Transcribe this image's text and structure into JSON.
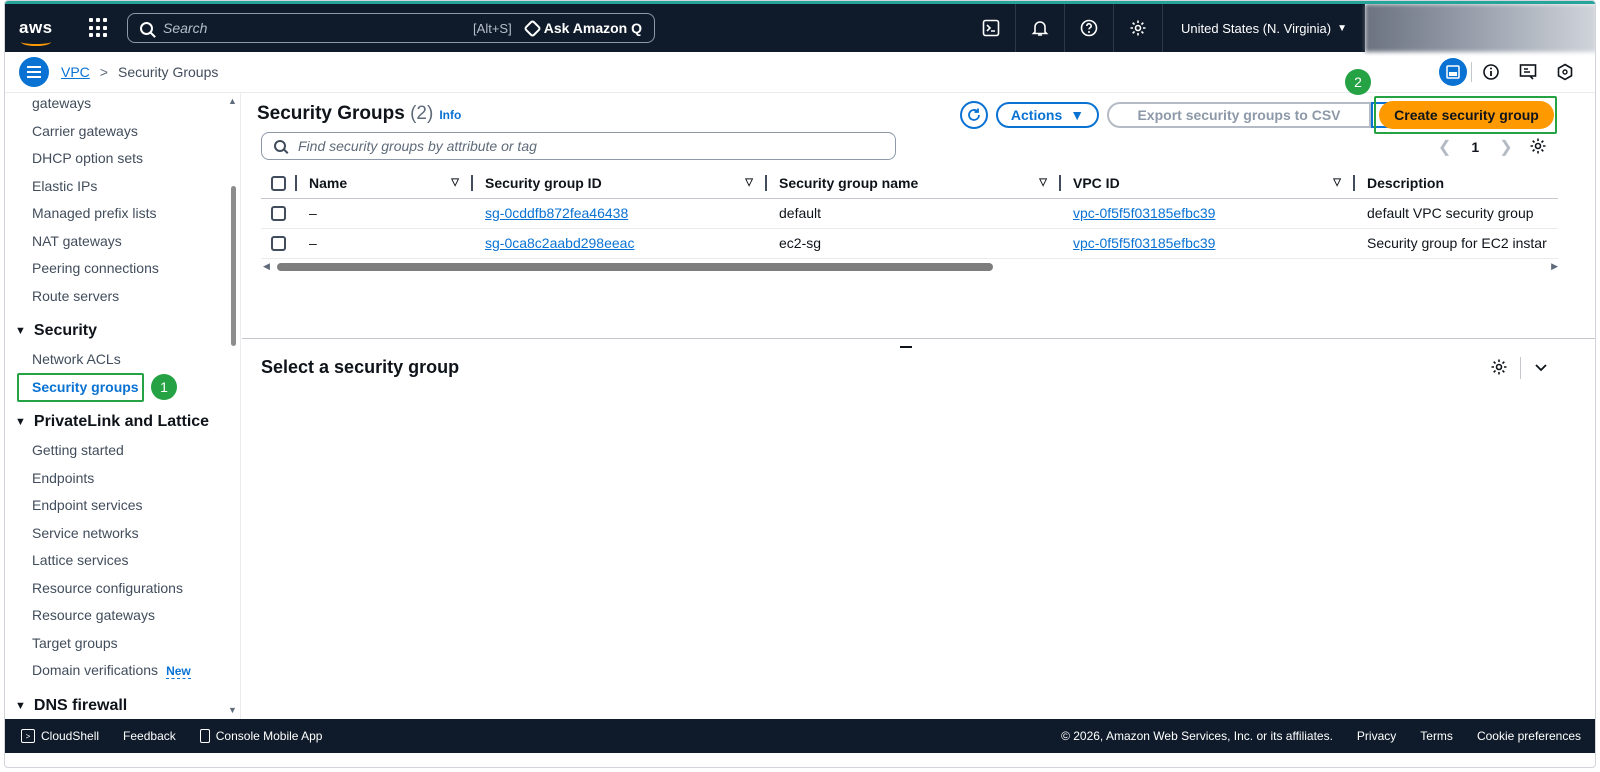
{
  "topnav": {
    "logo": "aws",
    "search_placeholder": "Search",
    "search_shortcut": "[Alt+S]",
    "ask_q": "Ask Amazon Q",
    "region": "United States (N. Virginia)"
  },
  "breadcrumb": {
    "parent": "VPC",
    "current": "Security Groups"
  },
  "sidebar": {
    "items_top": [
      "gateways",
      "Carrier gateways",
      "DHCP option sets",
      "Elastic IPs",
      "Managed prefix lists",
      "NAT gateways",
      "Peering connections",
      "Route servers"
    ],
    "section_security": "Security",
    "security_items": [
      "Network ACLs",
      "Security groups"
    ],
    "section_privatelink": "PrivateLink and Lattice",
    "privatelink_items": [
      "Getting started",
      "Endpoints",
      "Endpoint services",
      "Service networks",
      "Lattice services",
      "Resource configurations",
      "Resource gateways",
      "Target groups",
      "Domain verifications"
    ],
    "new_badge": "New",
    "section_dns": "DNS firewall"
  },
  "annotations": {
    "step1": "1",
    "step2": "2"
  },
  "table": {
    "title": "Security Groups",
    "count": "(2)",
    "info": "Info",
    "actions": "Actions",
    "export": "Export security groups to CSV",
    "create": "Create security group",
    "filter_placeholder": "Find security groups by attribute or tag",
    "page": "1",
    "columns": [
      "Name",
      "Security group ID",
      "Security group name",
      "VPC ID",
      "Description"
    ],
    "rows": [
      {
        "name": "–",
        "id": "sg-0cddfb872fea46438",
        "sgname": "default",
        "vpc": "vpc-0f5f5f03185efbc39",
        "desc": "default VPC security group"
      },
      {
        "name": "–",
        "id": "sg-0ca8c2aabd298eeac",
        "sgname": "ec2-sg",
        "vpc": "vpc-0f5f5f03185efbc39",
        "desc": "Security group for EC2 instar"
      }
    ]
  },
  "split_panel": {
    "title": "Select a security group"
  },
  "footer": {
    "cloudshell": "CloudShell",
    "feedback": "Feedback",
    "mobile": "Console Mobile App",
    "copyright": "© 2026, Amazon Web Services, Inc. or its affiliates.",
    "privacy": "Privacy",
    "terms": "Terms",
    "cookies": "Cookie preferences"
  },
  "colors": {
    "accent": "#0972d3",
    "cta": "#ff9900",
    "highlight": "#25a244",
    "nav_bg": "#0f1b2a"
  }
}
